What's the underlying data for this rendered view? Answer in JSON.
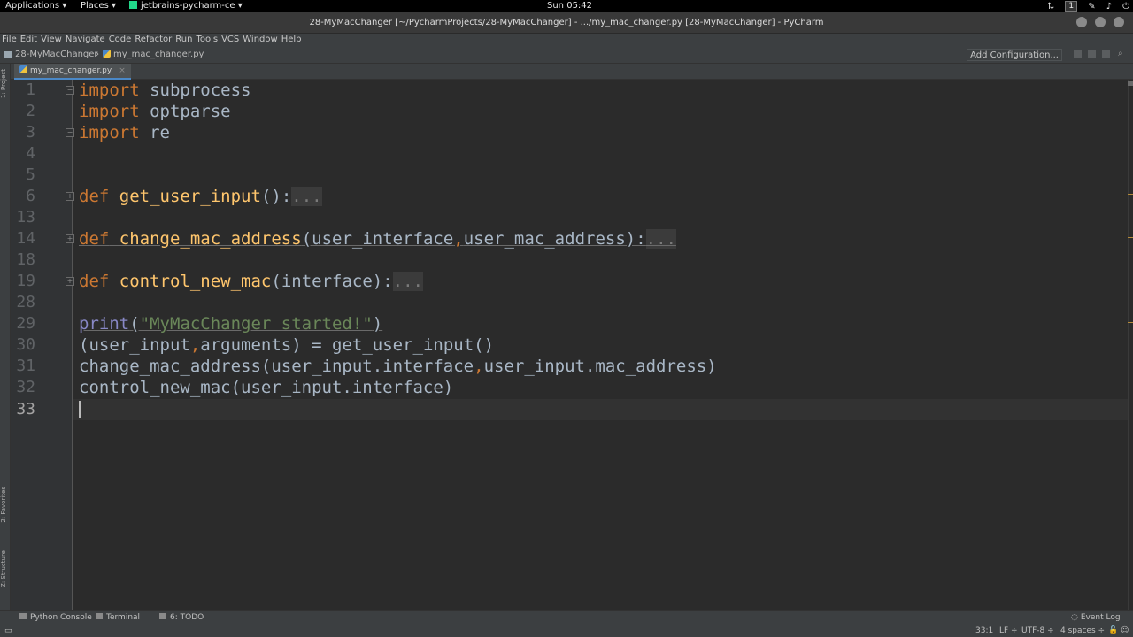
{
  "system_bar": {
    "applications": "Applications ▾",
    "places": "Places ▾",
    "active_app": "jetbrains-pycharm-ce ▾",
    "clock": "Sun 05:42",
    "workspace": "1"
  },
  "window": {
    "title": "28-MyMacChanger [~/PycharmProjects/28-MyMacChanger] - .../my_mac_changer.py [28-MyMacChanger] - PyCharm"
  },
  "menu": [
    "File",
    "Edit",
    "View",
    "Navigate",
    "Code",
    "Refactor",
    "Run",
    "Tools",
    "VCS",
    "Window",
    "Help"
  ],
  "navbar": {
    "project": "28-MyMacChanger",
    "file": "my_mac_changer.py",
    "add_configuration": "Add Configuration..."
  },
  "tabs": [
    {
      "label": "my_mac_changer.py",
      "active": true
    }
  ],
  "tool_windows": {
    "left": [
      "1: Project",
      "2: Favorites",
      "Z: Structure"
    ],
    "bottom": [
      "Python Console",
      "Terminal",
      "6: TODO"
    ],
    "event_log": "Event Log"
  },
  "editor": {
    "line_numbers": [
      "1",
      "2",
      "3",
      "4",
      "5",
      "6",
      "13",
      "14",
      "18",
      "19",
      "28",
      "29",
      "30",
      "31",
      "32",
      "33"
    ],
    "current_line": "33",
    "code": {
      "l1_kw": "import",
      "l1_rest": " subprocess",
      "l2_kw": "import",
      "l2_rest": " optparse",
      "l3_kw": "import",
      "l3_rest": " re",
      "l6_kw": "def",
      "l6_fn": "get_user_input",
      "l6_sig": "():",
      "l6_fold": "...",
      "l14_kw": "def",
      "l14_fn": "change_mac_address",
      "l14_a": "(user_interface",
      "l14_comma": ",",
      "l14_b": "user_mac_address):",
      "l14_fold": "...",
      "l19_kw": "def",
      "l19_fn": "control_new_mac",
      "l19_sig": "(interface):",
      "l19_fold": "...",
      "l29_bi": "print",
      "l29_open": "(",
      "l29_str": "\"MyMacChanger started!\"",
      "l29_close": ")",
      "l30_a": "(user_input",
      "l30_comma": ",",
      "l30_b": "arguments) = get_user_input()",
      "l31_a": "change_mac_address(user_input.interface",
      "l31_comma": ",",
      "l31_b": "user_input.mac_address)",
      "l32": "control_new_mac(user_input.interface)"
    }
  },
  "status": {
    "position": "33:1",
    "line_sep": "LF ÷",
    "encoding": "UTF-8 ÷",
    "indent": "4 spaces ÷"
  }
}
